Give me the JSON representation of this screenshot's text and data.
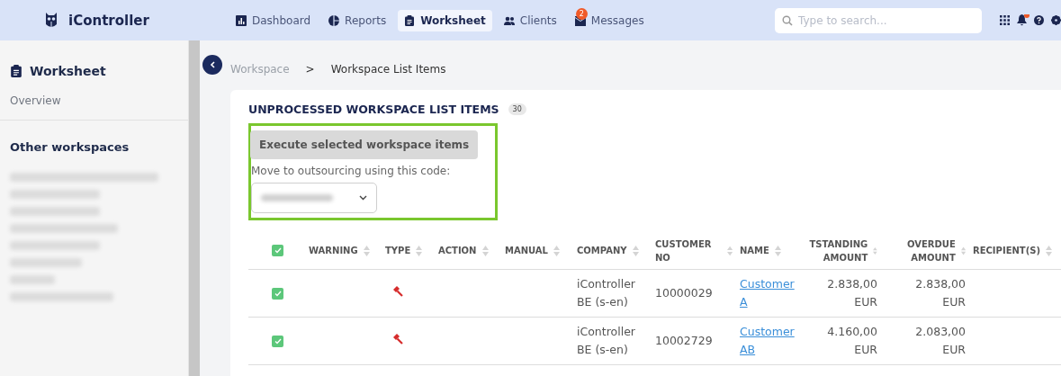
{
  "app": {
    "name": "iController"
  },
  "nav": [
    {
      "label": "Dashboard",
      "selected": false
    },
    {
      "label": "Reports",
      "selected": false
    },
    {
      "label": "Worksheet",
      "selected": true
    },
    {
      "label": "Clients",
      "selected": false
    },
    {
      "label": "Messages",
      "selected": false,
      "badge": "2"
    }
  ],
  "search": {
    "placeholder": "Type to search..."
  },
  "notifications": {
    "unread": true
  },
  "sidebar": {
    "title": "Worksheet",
    "overview": "Overview",
    "section": "Other workspaces",
    "items": [
      {
        "kind": "redacted"
      },
      {
        "kind": "redacted"
      },
      {
        "kind": "redacted"
      },
      {
        "kind": "redacted"
      },
      {
        "kind": "redacted"
      },
      {
        "kind": "redacted"
      },
      {
        "kind": "redacted"
      },
      {
        "kind": "redacted"
      }
    ]
  },
  "breadcrumb": [
    "Workspace",
    "Workspace List Items"
  ],
  "breadcrumb_separator": ">",
  "panel": {
    "title": "UNPROCESSED WORKSPACE LIST ITEMS",
    "count": "30",
    "execute_button": {
      "label": "Execute selected workspace items",
      "disabled": true
    },
    "outsourcing_label": "Move to outsourcing using this code:",
    "outsourcing_select": {
      "kind": "redacted"
    }
  },
  "table": {
    "all_checked": true,
    "columns": [
      "WARNING",
      "TYPE",
      "ACTION",
      "MANUAL",
      "COMPANY",
      "CUSTOMER NO",
      "NAME",
      "TSTANDING AMOUNT",
      "OVERDUE AMOUNT",
      "RECIPIENT(S)"
    ],
    "rows": [
      {
        "checked": true,
        "company": "iController BE (s-en)",
        "customer_no": "10000029",
        "name": "Customer A",
        "outstanding": "2.838,00 EUR",
        "overdue": "2.838,00 EUR"
      },
      {
        "checked": true,
        "company": "iController BE (s-en)",
        "customer_no": "10002729",
        "name": "Customer AB",
        "outstanding": "4.160,00 EUR",
        "overdue": "2.083,00 EUR"
      }
    ]
  }
}
